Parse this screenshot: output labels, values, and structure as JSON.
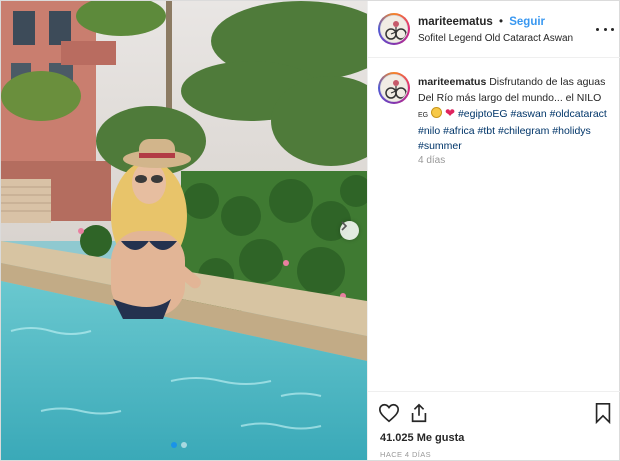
{
  "post": {
    "username": "mariteematus",
    "follow_label": "Seguir",
    "separator": "•",
    "location": "Sofitel Legend Old Cataract Aswan",
    "caption": {
      "username": "mariteematus",
      "text_1": "Disfrutando de las aguas Del Río más largo del mundo... el NILO",
      "flag_text": "EG",
      "hashtags": [
        "#egiptoEG",
        "#aswan",
        "#oldcataract",
        "#nilo",
        "#africa",
        "#tbt",
        "#chilegram",
        "#holidys",
        "#summer"
      ]
    },
    "time_ago": "4 días",
    "likes": "41.025 Me gusta",
    "posted": "HACE 4 DÍAS"
  },
  "icons": {
    "more": "more-options-icon",
    "like": "heart-outline-icon",
    "share": "share-icon",
    "save": "bookmark-icon",
    "next": "chevron-right-icon"
  },
  "colors": {
    "follow": "#3897f0",
    "hashtag": "#003569",
    "heart": "#e0245e",
    "muted": "#999999"
  },
  "carousel": {
    "slides": 2,
    "active": 1
  }
}
